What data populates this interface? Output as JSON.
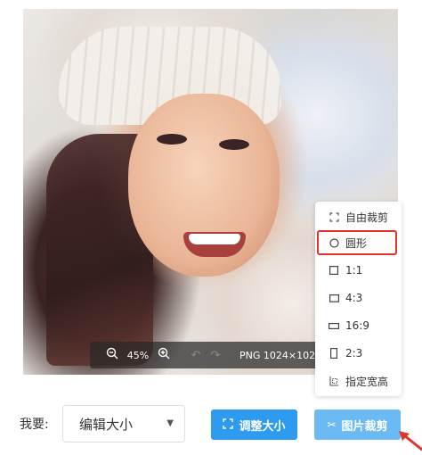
{
  "zoom_toolbar": {
    "zoom_out_icon": "zoom-out-icon",
    "zoom_percent": "45%",
    "zoom_in_icon": "zoom-in-icon",
    "undo_icon": "undo-icon",
    "redo_icon": "redo-icon",
    "image_info": "PNG 1024×102"
  },
  "controls": {
    "want_label": "我要:",
    "mode_select_value": "编辑大小",
    "adjust_button_label": "调整大小",
    "crop_button_label": "图片裁剪"
  },
  "crop_menu": {
    "items": [
      {
        "label": "自由裁剪",
        "icon": "free-crop-icon"
      },
      {
        "label": "圆形",
        "icon": "circle-icon"
      },
      {
        "label": "1:1",
        "icon": "square-icon"
      },
      {
        "label": "4:3",
        "icon": "ratio-4-3-icon"
      },
      {
        "label": "16:9",
        "icon": "ratio-16-9-icon"
      },
      {
        "label": "2:3",
        "icon": "ratio-2-3-icon"
      },
      {
        "label": "指定宽高",
        "icon": "custom-size-icon"
      }
    ],
    "highlight_color": "#e2332d"
  },
  "colors": {
    "primary_button": "#2d9bf0",
    "crop_button": "#6cbaf3"
  }
}
